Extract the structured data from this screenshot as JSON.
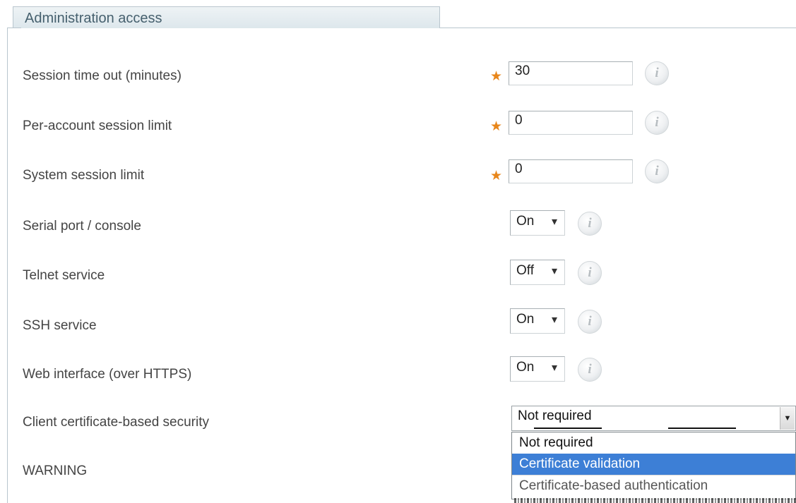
{
  "section": {
    "title": "Administration access"
  },
  "fields": {
    "session_timeout": {
      "label": "Session time out (minutes)",
      "value": "30",
      "required": true
    },
    "per_account_limit": {
      "label": "Per-account session limit",
      "value": "0",
      "required": true
    },
    "system_limit": {
      "label": "System session limit",
      "value": "0",
      "required": true
    },
    "serial_port": {
      "label": "Serial port / console",
      "value": "On"
    },
    "telnet": {
      "label": "Telnet service",
      "value": "Off"
    },
    "ssh": {
      "label": "SSH service",
      "value": "On"
    },
    "web_interface": {
      "label": "Web interface (over HTTPS)",
      "value": "On"
    },
    "client_cert": {
      "label": "Client certificate-based security",
      "value": "Not required",
      "options": [
        "Not required",
        "Certificate validation",
        "Certificate-based authentication"
      ],
      "highlighted_option": "Certificate validation"
    },
    "warning": {
      "label": "WARNING"
    }
  },
  "icons": {
    "required_marker": "star",
    "info": "info-icon",
    "dropdown_arrow": "chevron-down-icon"
  },
  "glyphs": {
    "required": "★",
    "info": "i",
    "arrow": "▾",
    "wide_arrow": "▼"
  },
  "colors": {
    "required": "#e8861a",
    "highlight": "#3d7fd6",
    "section_text": "#46606e"
  }
}
